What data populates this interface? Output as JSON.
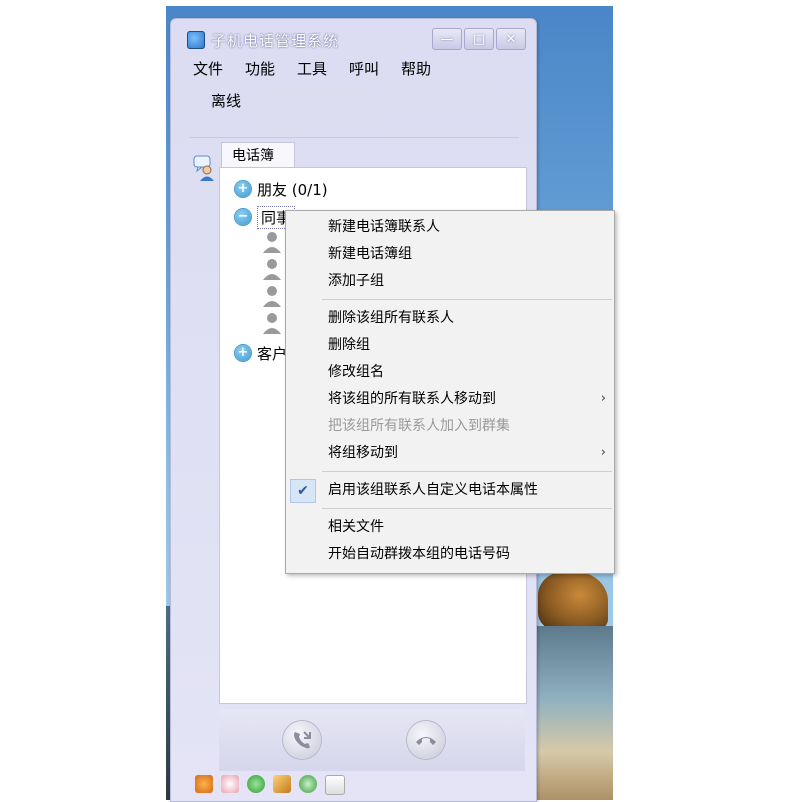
{
  "window": {
    "title": "子机电话管理系统",
    "controls": {
      "minimize": "—",
      "maximize": "□",
      "close": "✕"
    }
  },
  "menu": [
    "文件",
    "功能",
    "工具",
    "呼叫",
    "帮助"
  ],
  "status": "离线",
  "tab": {
    "label": "电话簿"
  },
  "tree": {
    "groups": [
      {
        "label": "朋友 (0/1)",
        "expanded": false
      },
      {
        "label": "同事",
        "expanded": true,
        "members": 4
      },
      {
        "label": "客户",
        "expanded": false
      }
    ]
  },
  "context_menu": {
    "items": [
      {
        "label": "新建电话簿联系人"
      },
      {
        "label": "新建电话簿组"
      },
      {
        "label": "添加子组"
      },
      {
        "label": "删除该组所有联系人"
      },
      {
        "label": "删除组"
      },
      {
        "label": "修改组名"
      },
      {
        "label": "将该组的所有联系人移动到",
        "submenu": true
      },
      {
        "label": "把该组所有联系人加入到群集",
        "disabled": true
      },
      {
        "label": "将组移动到",
        "submenu": true
      },
      {
        "label": "启用该组联系人自定义电话本属性",
        "checked": true
      },
      {
        "label": "相关文件"
      },
      {
        "label": "开始自动群拨本组的电话号码"
      }
    ],
    "submenu_arrow": "›",
    "check_mark": "✔"
  },
  "icons": {
    "expand": "+",
    "collapse": "−"
  },
  "colors": {
    "window_bg": "#dcdcf2",
    "accent_blue": "#3b9bd0",
    "menu_bg": "#f2f2f2",
    "disabled_text": "#9a9a9a"
  }
}
